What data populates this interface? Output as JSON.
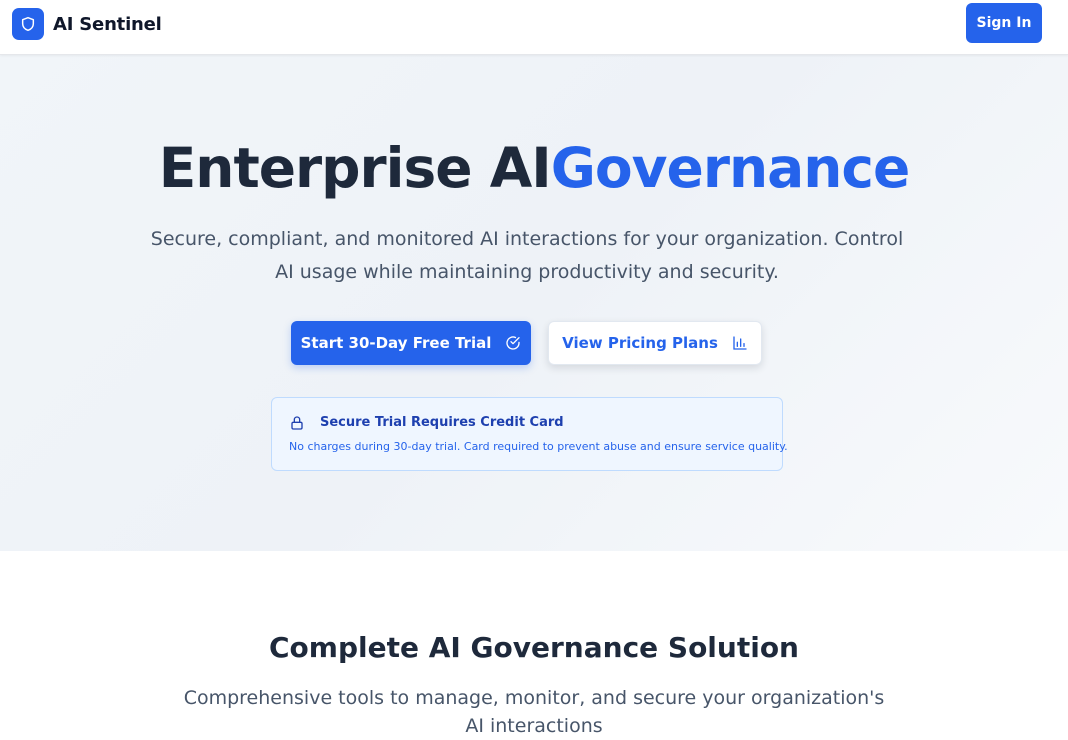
{
  "brand": {
    "name": "AI Sentinel",
    "logo_icon": "shield-icon"
  },
  "nav": {
    "sign_in": "Sign In"
  },
  "hero": {
    "title_main": "Enterprise AI",
    "title_accent": "Governance",
    "subtitle": "Secure, compliant, and monitored AI interactions for your organization. Control AI usage while maintaining productivity and security.",
    "primary_cta": {
      "label": "Start 30-Day Free Trial",
      "icon": "check-circle-icon"
    },
    "secondary_cta": {
      "label": "View Pricing Plans",
      "icon": "bar-chart-icon"
    },
    "notice": {
      "icon": "lock-icon",
      "title": "Secure Trial Requires Credit Card",
      "description": "No charges during 30-day trial. Card required to prevent abuse and ensure service quality."
    }
  },
  "features": {
    "title": "Complete AI Governance Solution",
    "subtitle": "Comprehensive tools to manage, monitor, and secure your organization's AI interactions"
  },
  "colors": {
    "primary": "#2563eb",
    "heading": "#1e293b",
    "muted": "#475569",
    "notice_bg": "#eff6ff"
  }
}
